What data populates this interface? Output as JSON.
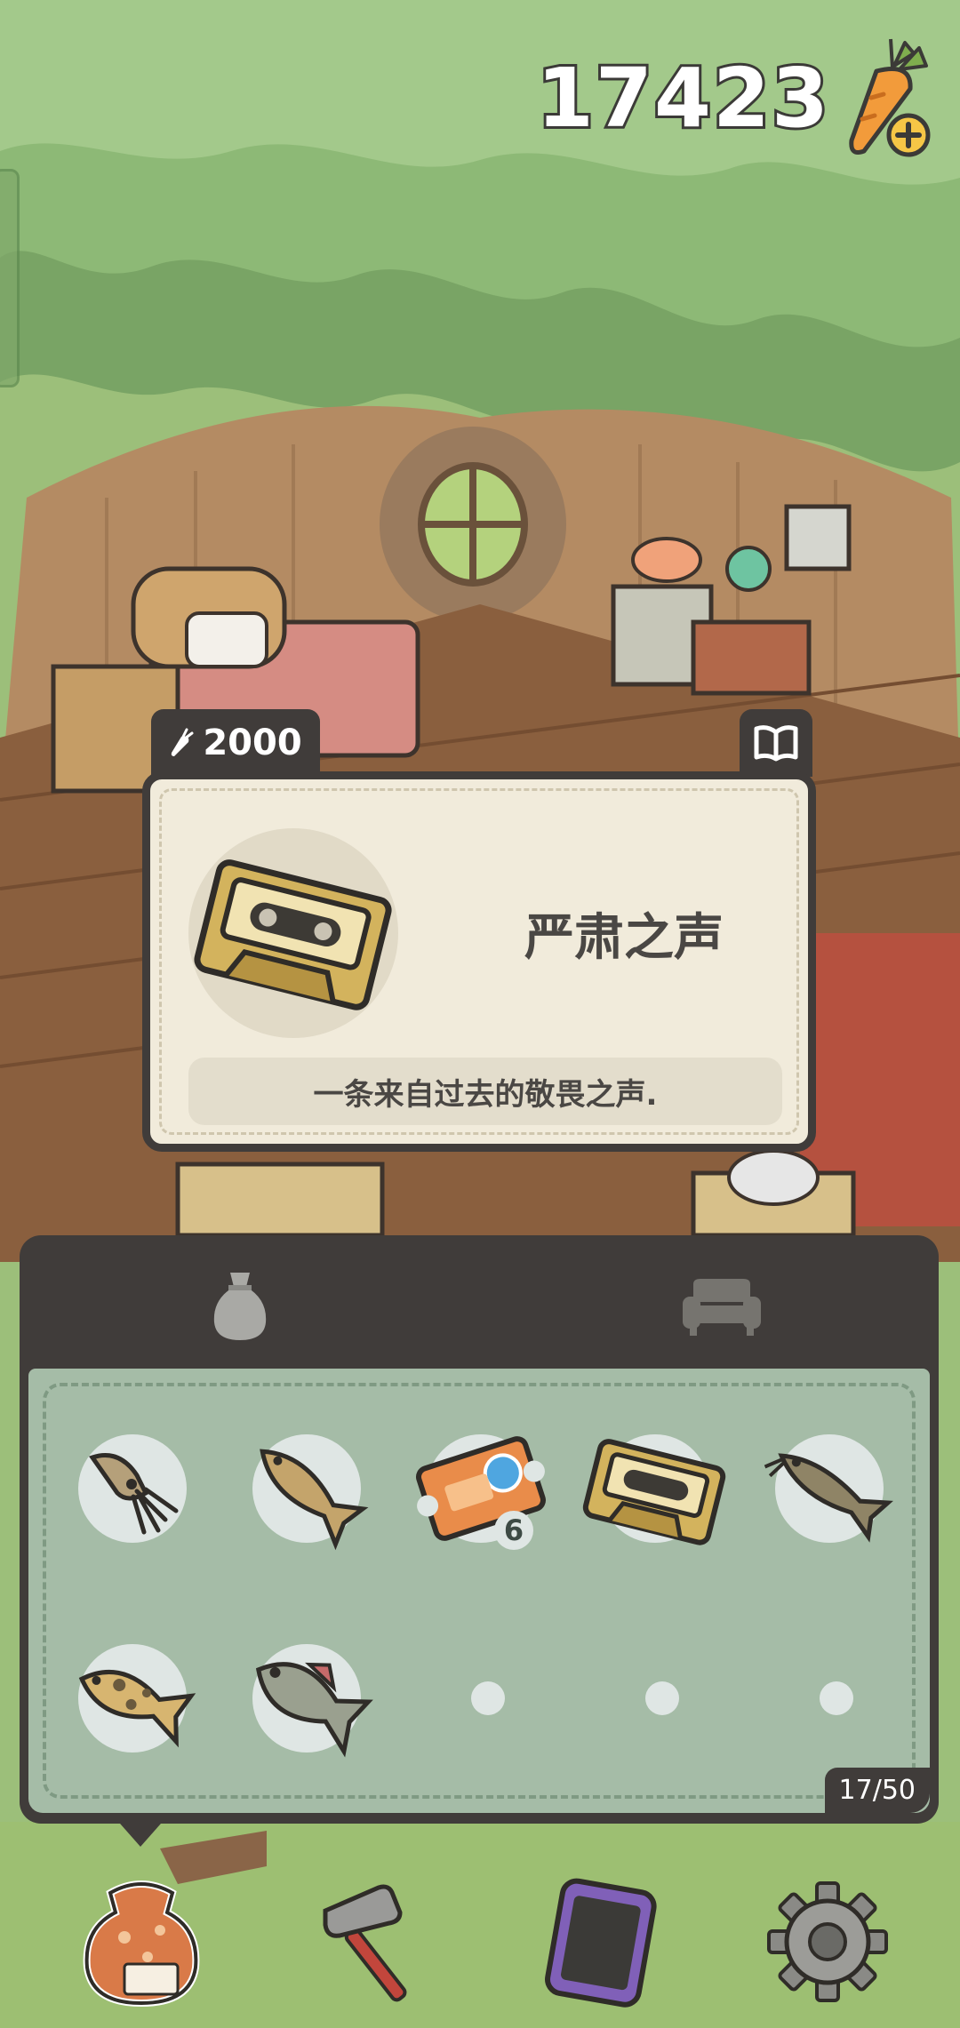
{
  "currency": {
    "carrots": "17423",
    "carrot_icon": "carrot-plus-icon"
  },
  "item_detail": {
    "price": "2000",
    "name": "严肃之声",
    "description": "一条来自过去的敬畏之声.",
    "icon": "cassette-tape-icon"
  },
  "inventory": {
    "tabs": [
      "bag-tab-icon",
      "furniture-tab-icon"
    ],
    "active_tab": "bag",
    "items": [
      {
        "name": "squid",
        "icon": "squid-icon"
      },
      {
        "name": "cod",
        "icon": "cod-fish-icon"
      },
      {
        "name": "gacha-ticket",
        "icon": "ticket-icon",
        "quantity": "6"
      },
      {
        "name": "cassette",
        "icon": "cassette-tape-icon"
      },
      {
        "name": "catfish",
        "icon": "catfish-icon"
      },
      {
        "name": "spotted-fish",
        "icon": "spotted-fish-icon"
      },
      {
        "name": "bass",
        "icon": "bass-fish-icon"
      },
      {
        "name": "empty",
        "icon": ""
      },
      {
        "name": "empty",
        "icon": ""
      },
      {
        "name": "empty",
        "icon": ""
      }
    ],
    "capacity": "17/50"
  },
  "nav": [
    "bag-icon",
    "hammer-icon",
    "phone-icon",
    "gear-icon"
  ],
  "colors": {
    "panel": "#403c3a",
    "grid": "#a5bca7",
    "card": "#f1ebdb",
    "leaf": "#7fa86a"
  }
}
